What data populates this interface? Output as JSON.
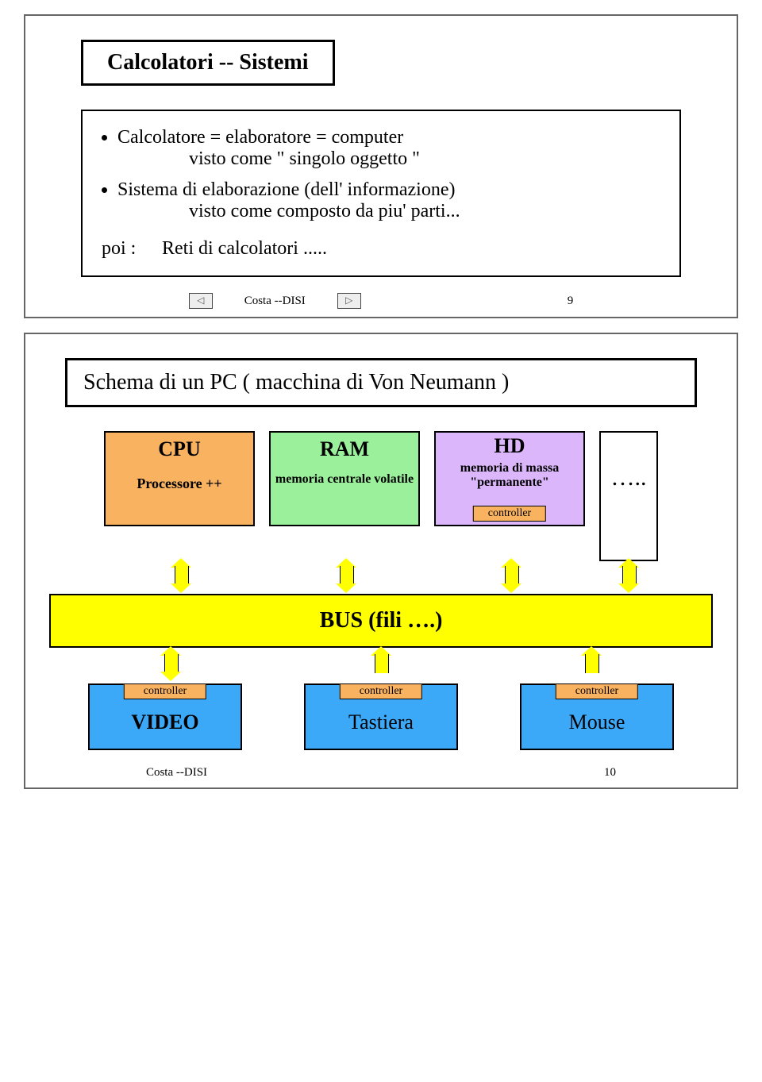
{
  "slide1": {
    "title": "Calcolatori  -- Sistemi",
    "bullet1_line1": "Calcolatore = elaboratore = computer",
    "bullet1_line2": "visto come   \" singolo oggetto \"",
    "bullet2_line1": "Sistema di elaborazione (dell' informazione)",
    "bullet2_line2": "visto come composto da piu' parti...",
    "poi_label": "poi :",
    "poi_text": "Reti di calcolatori .....",
    "footer_center": "Costa --DISI",
    "footer_page": "9"
  },
  "slide2": {
    "title": "Schema di un PC    ( macchina di Von Neumann )",
    "cpu_label": "CPU",
    "cpu_sub": "Processore ++",
    "ram_label": "RAM",
    "ram_sub": "memoria centrale volatile",
    "hd_label": "HD",
    "hd_sub1": "memoria di massa",
    "hd_sub2": "\"permanente\"",
    "hd_ctrl": "controller",
    "dots": "…..",
    "bus_label": "BUS    (fili ….)",
    "io1_ctrl": "controller",
    "io1_label": "VIDEO",
    "io2_ctrl": "controller",
    "io2_label": "Tastiera",
    "io3_ctrl": "controller",
    "io3_label": "Mouse",
    "footer_center": "Costa --DISI",
    "footer_page": "10"
  }
}
